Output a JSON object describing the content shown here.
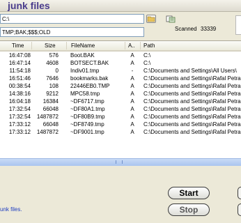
{
  "header": {
    "title": "junk files"
  },
  "inputs": {
    "path_value": "C:\\",
    "extensions_value": "TMP;BAK;$$$;OLD"
  },
  "scan": {
    "label": "Scanned",
    "count": "33339"
  },
  "table": {
    "columns": [
      "Time",
      "Size",
      "FileName",
      "A..",
      "Path"
    ],
    "rows": [
      {
        "time": "16:47:08",
        "size": "576",
        "name": "Boot.BAK",
        "attr": "A",
        "path": "C:\\"
      },
      {
        "time": "16:47:14",
        "size": "4608",
        "name": "BOTSECT.BAK",
        "attr": "A",
        "path": "C:\\"
      },
      {
        "time": "11:54:18",
        "size": "0",
        "name": "Indiv01.tmp",
        "attr": "-",
        "path": "C:\\Documents and Settings\\All Users\\"
      },
      {
        "time": "16:51:46",
        "size": "7646",
        "name": "bookmarks.bak",
        "attr": "A",
        "path": "C:\\Documents and Settings\\Rafal Petra"
      },
      {
        "time": "00:38:54",
        "size": "108",
        "name": "22446EB0.TMP",
        "attr": "A",
        "path": "C:\\Documents and Settings\\Rafal Petra"
      },
      {
        "time": "14:38:16",
        "size": "9212",
        "name": "MPC58.tmp",
        "attr": "A",
        "path": "C:\\Documents and Settings\\Rafal Petra"
      },
      {
        "time": "16:04:18",
        "size": "16384",
        "name": "~DF6717.tmp",
        "attr": "A",
        "path": "C:\\Documents and Settings\\Rafal Petra"
      },
      {
        "time": "17:32:54",
        "size": "66048",
        "name": "~DF80A1.tmp",
        "attr": "A",
        "path": "C:\\Documents and Settings\\Rafal Petra"
      },
      {
        "time": "17:32:54",
        "size": "1487872",
        "name": "~DF80B9.tmp",
        "attr": "A",
        "path": "C:\\Documents and Settings\\Rafal Petra"
      },
      {
        "time": "17:33:12",
        "size": "66048",
        "name": "~DF8749.tmp",
        "attr": "A",
        "path": "C:\\Documents and Settings\\Rafal Petra"
      },
      {
        "time": "17:33:12",
        "size": "1487872",
        "name": "~DF9001.tmp",
        "attr": "A",
        "path": "C:\\Documents and Settings\\Rafal Petra"
      }
    ]
  },
  "buttons": {
    "start": "Start",
    "stop": "Stop"
  },
  "status": {
    "text": "unk files."
  },
  "icons": {
    "browse": "folder-icon",
    "scanner": "scanner-icon"
  }
}
